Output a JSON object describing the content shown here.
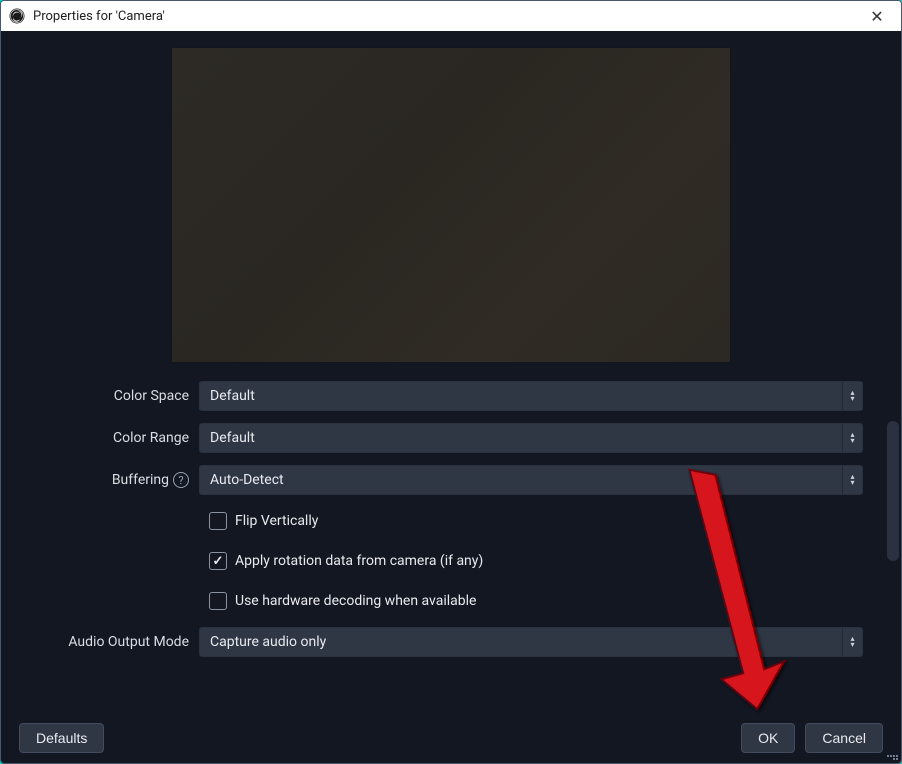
{
  "window": {
    "title": "Properties for 'Camera'"
  },
  "form": {
    "color_space": {
      "label": "Color Space",
      "value": "Default"
    },
    "color_range": {
      "label": "Color Range",
      "value": "Default"
    },
    "buffering": {
      "label": "Buffering",
      "value": "Auto-Detect"
    },
    "flip_vertically": {
      "label": "Flip Vertically",
      "checked": false
    },
    "apply_rotation": {
      "label": "Apply rotation data from camera (if any)",
      "checked": true
    },
    "hw_decode": {
      "label": "Use hardware decoding when available",
      "checked": false
    },
    "audio_output": {
      "label": "Audio Output Mode",
      "value": "Capture audio only"
    }
  },
  "buttons": {
    "defaults": "Defaults",
    "ok": "OK",
    "cancel": "Cancel"
  },
  "icons": {
    "close": "✕",
    "help": "?"
  }
}
